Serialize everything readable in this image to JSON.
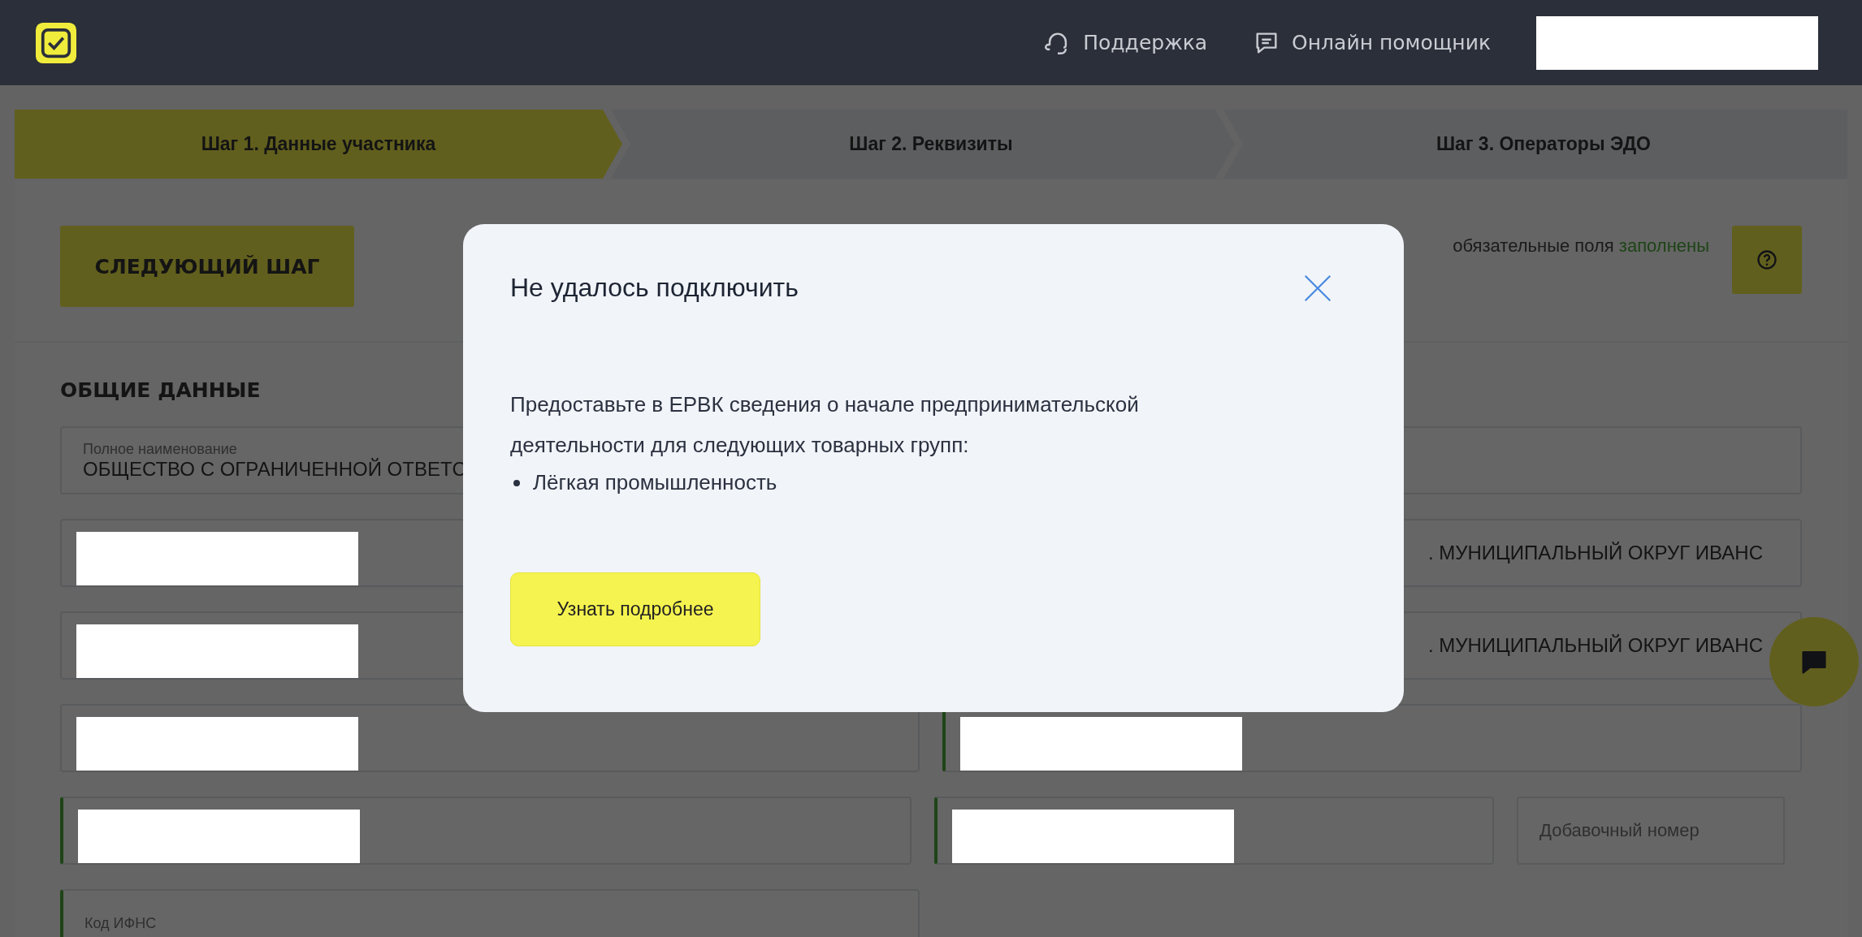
{
  "header": {
    "links": [
      {
        "kind": "support",
        "label": "Поддержка"
      },
      {
        "kind": "chat",
        "label": "Онлайн помощник"
      }
    ]
  },
  "steps": [
    {
      "label": "Шаг 1. Данные участника",
      "selected": true
    },
    {
      "label": "Шаг 2. Реквизиты",
      "selected": false
    },
    {
      "label": "Шаг 3. Операторы ЭДО",
      "selected": false
    }
  ],
  "toolbar": {
    "next_button": "СЛЕДУЮЩИЙ ШАГ",
    "status": {
      "text": "обязательные поля",
      "highlight": "заполнены"
    }
  },
  "section_title": "ОБЩИЕ ДАННЫЕ",
  "rows": [
    [
      {
        "label": "Полное наименование",
        "value": "ОБЩЕСТВО С ОГРАНИЧЕННОЙ ОТВЕТС",
        "redacted": false,
        "valid": false
      },
      {}
    ],
    [
      {
        "redacted": true,
        "valid": false
      },
      {
        "value": ". МУНИЦИПАЛЬНЫЙ ОКРУГ ИВАНС"
      }
    ],
    [
      {
        "redacted": true,
        "valid": false
      },
      {
        "value": ". МУНИЦИПАЛЬНЫЙ ОКРУГ ИВАНС"
      }
    ],
    [
      {
        "redacted": true,
        "valid": false
      },
      {
        "redacted": true,
        "valid": true
      }
    ],
    [
      {
        "redacted": true,
        "valid": true
      },
      {
        "redacted": true,
        "valid": true
      },
      {
        "placeholder": "Добавочный номер",
        "redacted": false,
        "valid": false
      }
    ],
    [
      {
        "label": "Код ИФНС",
        "redacted": false,
        "valid": true
      }
    ]
  ],
  "modal": {
    "title": "Не удалось подключить",
    "message": "Предоставьте в ЕРВК сведения о начале предпринимательской деятельности для следующих товарных групп:",
    "items": [
      "Лёгкая промышленность"
    ],
    "button": "Узнать подробнее"
  }
}
